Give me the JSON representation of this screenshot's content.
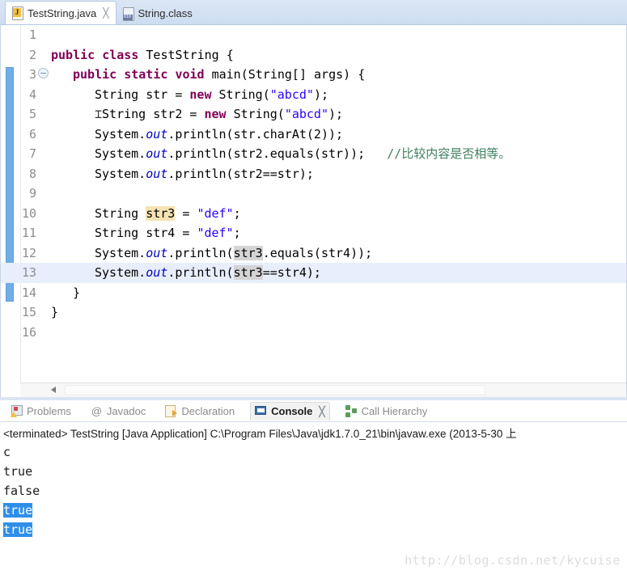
{
  "editor_tabs": [
    {
      "label": "TestString.java",
      "icon": "java-file-icon",
      "active": true,
      "closable": true
    },
    {
      "label": "String.class",
      "icon": "class-file-icon",
      "active": false,
      "closable": false
    }
  ],
  "close_glyph": "╳",
  "code": {
    "language": "java",
    "current_line": 13,
    "range_indicator": {
      "from_line": 3,
      "to_line": 14
    },
    "lines": [
      {
        "num": "1",
        "fold": false,
        "indent": 0,
        "tokens": []
      },
      {
        "num": "2",
        "fold": false,
        "indent": 0,
        "tokens": [
          {
            "t": "public",
            "c": "kw"
          },
          {
            "t": " ",
            "c": ""
          },
          {
            "t": "class",
            "c": "kw"
          },
          {
            "t": " TestString {",
            "c": ""
          }
        ]
      },
      {
        "num": "3",
        "fold": true,
        "indent": 1,
        "tokens": [
          {
            "t": "public",
            "c": "kw"
          },
          {
            "t": " ",
            "c": ""
          },
          {
            "t": "static",
            "c": "kw"
          },
          {
            "t": " ",
            "c": ""
          },
          {
            "t": "void",
            "c": "kw"
          },
          {
            "t": " main(String[] args) {",
            "c": ""
          }
        ]
      },
      {
        "num": "4",
        "fold": false,
        "indent": 2,
        "tokens": [
          {
            "t": "String str = ",
            "c": ""
          },
          {
            "t": "new",
            "c": "kw"
          },
          {
            "t": " String(",
            "c": ""
          },
          {
            "t": "\"abcd\"",
            "c": "str"
          },
          {
            "t": ");",
            "c": ""
          }
        ]
      },
      {
        "num": "5",
        "fold": false,
        "indent": 2,
        "caret": true,
        "tokens": [
          {
            "t": "String str2 = ",
            "c": ""
          },
          {
            "t": "new",
            "c": "kw"
          },
          {
            "t": " String(",
            "c": ""
          },
          {
            "t": "\"abcd\"",
            "c": "str"
          },
          {
            "t": ");",
            "c": ""
          }
        ]
      },
      {
        "num": "6",
        "fold": false,
        "indent": 2,
        "tokens": [
          {
            "t": "System.",
            "c": ""
          },
          {
            "t": "out",
            "c": "fld"
          },
          {
            "t": ".println(str.charAt(2));",
            "c": ""
          }
        ]
      },
      {
        "num": "7",
        "fold": false,
        "indent": 2,
        "tokens": [
          {
            "t": "System.",
            "c": ""
          },
          {
            "t": "out",
            "c": "fld"
          },
          {
            "t": ".println(str2.equals(str));",
            "c": ""
          },
          {
            "t": "   ",
            "c": ""
          },
          {
            "t": "//比较内容是否相等。",
            "c": "cmt"
          }
        ]
      },
      {
        "num": "8",
        "fold": false,
        "indent": 2,
        "tokens": [
          {
            "t": "System.",
            "c": ""
          },
          {
            "t": "out",
            "c": "fld"
          },
          {
            "t": ".println(str2==str);",
            "c": ""
          }
        ]
      },
      {
        "num": "9",
        "fold": false,
        "indent": 0,
        "tokens": []
      },
      {
        "num": "10",
        "fold": false,
        "indent": 2,
        "tokens": [
          {
            "t": "String ",
            "c": ""
          },
          {
            "t": "str3",
            "c": "occ-w"
          },
          {
            "t": " = ",
            "c": ""
          },
          {
            "t": "\"def\"",
            "c": "str"
          },
          {
            "t": ";",
            "c": ""
          }
        ]
      },
      {
        "num": "11",
        "fold": false,
        "indent": 2,
        "tokens": [
          {
            "t": "String str4 = ",
            "c": ""
          },
          {
            "t": "\"def\"",
            "c": "str"
          },
          {
            "t": ";",
            "c": ""
          }
        ]
      },
      {
        "num": "12",
        "fold": false,
        "indent": 2,
        "tokens": [
          {
            "t": "System.",
            "c": ""
          },
          {
            "t": "out",
            "c": "fld"
          },
          {
            "t": ".println(",
            "c": ""
          },
          {
            "t": "str3",
            "c": "occ-r"
          },
          {
            "t": ".equals(str4));",
            "c": ""
          }
        ]
      },
      {
        "num": "13",
        "fold": false,
        "indent": 2,
        "current": true,
        "tokens": [
          {
            "t": "System.",
            "c": ""
          },
          {
            "t": "out",
            "c": "fld"
          },
          {
            "t": ".println(",
            "c": ""
          },
          {
            "t": "str3",
            "c": "occ-r"
          },
          {
            "t": "==str4);",
            "c": ""
          }
        ]
      },
      {
        "num": "14",
        "fold": false,
        "indent": 1,
        "tokens": [
          {
            "t": "}",
            "c": ""
          }
        ]
      },
      {
        "num": "15",
        "fold": false,
        "indent": 0,
        "tokens": [
          {
            "t": "}",
            "c": ""
          }
        ]
      },
      {
        "num": "16",
        "fold": false,
        "indent": 0,
        "tokens": []
      }
    ]
  },
  "view_tabs": [
    {
      "label": "Problems",
      "icon": "problems-icon",
      "active": false,
      "closable": false
    },
    {
      "label": "Javadoc",
      "icon": "javadoc-icon",
      "active": false,
      "closable": false
    },
    {
      "label": "Declaration",
      "icon": "declaration-icon",
      "active": false,
      "closable": false
    },
    {
      "label": "Console",
      "icon": "console-icon",
      "active": true,
      "closable": true
    },
    {
      "label": "Call Hierarchy",
      "icon": "call-hierarchy-icon",
      "active": false,
      "closable": false
    }
  ],
  "console": {
    "launch_line": "<terminated> TestString [Java Application] C:\\Program Files\\Java\\jdk1.7.0_21\\bin\\javaw.exe (2013-5-30 上",
    "output": [
      {
        "text": "c",
        "selected": false
      },
      {
        "text": "true",
        "selected": false
      },
      {
        "text": "false",
        "selected": false
      },
      {
        "text": "true",
        "selected": true
      },
      {
        "text": "true",
        "selected": true
      }
    ]
  },
  "watermark": "http://blog.csdn.net/kycuise",
  "colors": {
    "keyword": "#7f0055",
    "string": "#2a00ff",
    "comment": "#3f7f5f",
    "field": "#0000c0",
    "selection": "#2f8fe8",
    "current_line": "#e8eefb",
    "occurrence_write": "#f5e3b3",
    "occurrence_read": "#d4d4d4",
    "range_bar": "#72aee6"
  }
}
